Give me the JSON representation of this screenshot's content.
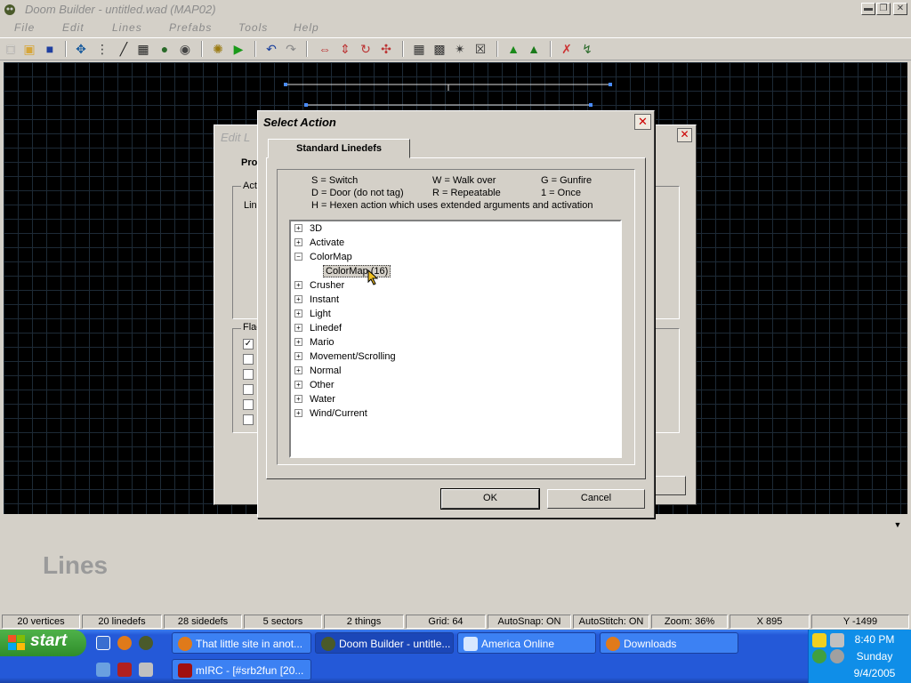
{
  "window": {
    "title": "Doom Builder - untitled.wad (MAP02)"
  },
  "menu": [
    "File",
    "Edit",
    "Lines",
    "Prefabs",
    "Tools",
    "Help"
  ],
  "mode_label": "Lines",
  "status": {
    "vertices": "20 vertices",
    "linedefs": "20 linedefs",
    "sidedefs": "28 sidedefs",
    "sectors": "5 sectors",
    "things": "2 things",
    "grid": "Grid: 64",
    "autosnap": "AutoSnap: ON",
    "autostitch": "AutoStitch: ON",
    "zoom": "Zoom: 36%",
    "x": "X 895",
    "y": "Y -1499"
  },
  "edit_dialog": {
    "title": "Edit L",
    "tab": "Pro",
    "act": "Act",
    "lin": "Lin",
    "flag": "Flag"
  },
  "select_action": {
    "title": "Select Action",
    "tab": "Standard Linedefs",
    "legend": {
      "s": "S = Switch",
      "w": "W = Walk over",
      "g": "G = Gunfire",
      "d": "D = Door (do not tag)",
      "r": "R = Repeatable",
      "once": "1 = Once",
      "h": "H = Hexen action which uses extended arguments and activation"
    },
    "tree": [
      "3D",
      "Activate",
      "ColorMap",
      "Crusher",
      "Instant",
      "Light",
      "Linedef",
      "Mario",
      "Movement/Scrolling",
      "Normal",
      "Other",
      "Water",
      "Wind/Current"
    ],
    "expanded_child": "ColorMap (16)",
    "ok": "OK",
    "cancel": "Cancel"
  },
  "taskbar": {
    "start": "start",
    "tasks": [
      "That little site in anot...",
      "Doom Builder - untitle...",
      "America  Online",
      "Downloads",
      "mIRC - [#srb2fun [20..."
    ],
    "clock": {
      "time": "8:40 PM",
      "day": "Sunday",
      "date": "9/4/2005"
    }
  },
  "colors": {
    "canvas": "#000000",
    "grid": "#1d2a36",
    "taskbar": "#2459d8",
    "start": "#3a9a34",
    "tray": "#0f8ee8"
  }
}
